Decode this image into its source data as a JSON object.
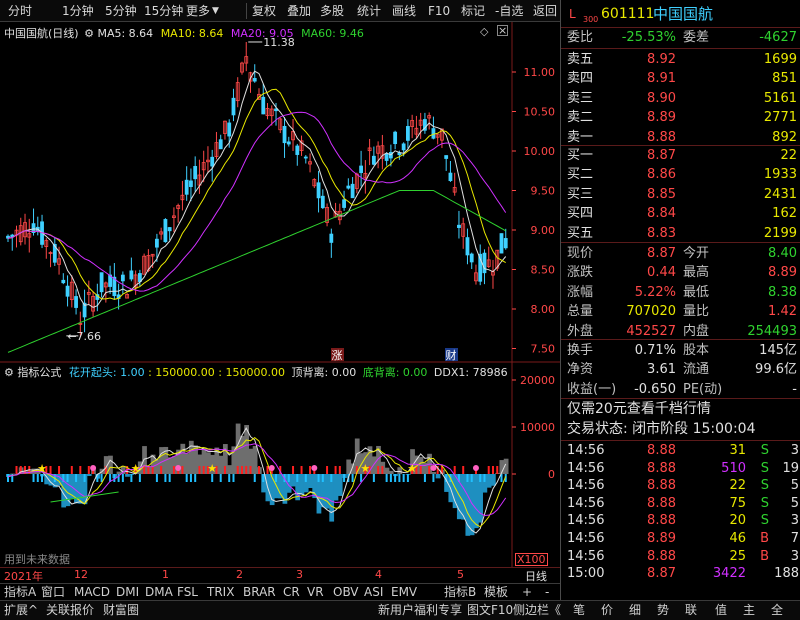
{
  "toolbar": {
    "items": [
      "分时",
      "1分钟",
      "5分钟",
      "15分钟",
      "更多",
      "复权",
      "叠加",
      "多股",
      "统计",
      "画线",
      "F10",
      "标记",
      "-自选",
      "返回"
    ]
  },
  "main_chart": {
    "stock_name": "中国国航",
    "period": "(日线)",
    "ma5": "MA5: 8.64",
    "ma10": "MA10: 8.64",
    "ma20": "MA20: 9.05",
    "ma60": "MA60: 9.46",
    "high_label": "11.38",
    "low_label": "7.66",
    "price_ticks": [
      "11.00",
      "10.50",
      "10.00",
      "9.50",
      "9.00",
      "8.50",
      "8.00",
      "7.50"
    ],
    "markers": [
      "涨",
      "财"
    ]
  },
  "indicator": {
    "name": "指标公式",
    "f1": "花开起头: 1.00",
    "f2": "150000.00",
    "f3": "150000.00",
    "f4": "顶背离: 0.00",
    "f5": "底背离: 0.00",
    "f6": "DDX1: 78986",
    "ticks": [
      "20000",
      "10000",
      "0"
    ],
    "scale": "X100",
    "note": "用到未来数据"
  },
  "date_axis": {
    "labels": [
      "2021年",
      "12",
      "1",
      "2",
      "3",
      "4",
      "5"
    ],
    "period_tab": "日线"
  },
  "tabs1": [
    "指标A",
    "窗口",
    "MACD",
    "DMI",
    "DMA",
    "FSL",
    "TRIX",
    "BRAR",
    "CR",
    "VR",
    "OBV",
    "ASI",
    "EMV",
    "指标B",
    "模板",
    "+",
    "-"
  ],
  "tabs2": [
    "扩展^",
    "关联报价",
    "财富圈",
    "新用户福利专享",
    "图文F10",
    "侧边栏《"
  ],
  "panel": {
    "l_badge": "L",
    "code_sub": "300",
    "code": "601111",
    "name": "中国国航",
    "weibi_label": "委比",
    "weibi": "-25.53%",
    "weicha_label": "委差",
    "weicha": "-4627",
    "asks": [
      {
        "label": "卖五",
        "price": "8.92",
        "vol": "1699"
      },
      {
        "label": "卖四",
        "price": "8.91",
        "vol": "851"
      },
      {
        "label": "卖三",
        "price": "8.90",
        "vol": "5161"
      },
      {
        "label": "卖二",
        "price": "8.89",
        "vol": "2771"
      },
      {
        "label": "卖一",
        "price": "8.88",
        "vol": "892"
      }
    ],
    "bids": [
      {
        "label": "买一",
        "price": "8.87",
        "vol": "22"
      },
      {
        "label": "买二",
        "price": "8.86",
        "vol": "1933"
      },
      {
        "label": "买三",
        "price": "8.85",
        "vol": "2431"
      },
      {
        "label": "买四",
        "price": "8.84",
        "vol": "162"
      },
      {
        "label": "买五",
        "price": "8.83",
        "vol": "2199"
      }
    ],
    "stats": [
      {
        "l1": "现价",
        "v1": "8.87",
        "c1": "red",
        "l2": "今开",
        "v2": "8.40",
        "c2": "green"
      },
      {
        "l1": "涨跌",
        "v1": "0.44",
        "c1": "red",
        "l2": "最高",
        "v2": "8.89",
        "c2": "red"
      },
      {
        "l1": "涨幅",
        "v1": "5.22%",
        "c1": "red",
        "l2": "最低",
        "v2": "8.38",
        "c2": "green"
      },
      {
        "l1": "总量",
        "v1": "707020",
        "c1": "yellow",
        "l2": "量比",
        "v2": "1.42",
        "c2": "red"
      },
      {
        "l1": "外盘",
        "v1": "452527",
        "c1": "red",
        "l2": "内盘",
        "v2": "254493",
        "c2": "green"
      }
    ],
    "stats2": [
      {
        "l1": "换手",
        "v1": "0.71%",
        "l2": "股本",
        "v2": "145亿"
      },
      {
        "l1": "净资",
        "v1": "3.61",
        "l2": "流通",
        "v2": "99.6亿"
      },
      {
        "l1": "收益(一)",
        "v1": "-0.650",
        "l2": "PE(动)",
        "v2": "-"
      }
    ],
    "promo": "仅需20元查看千档行情",
    "status": "交易状态: 闭市阶段 15:00:04",
    "ticks": [
      {
        "t": "14:56",
        "p": "8.88",
        "v": "31",
        "vc": "yellow",
        "d": "S",
        "dc": "green",
        "n": "3"
      },
      {
        "t": "14:56",
        "p": "8.88",
        "v": "510",
        "vc": "purple",
        "d": "S",
        "dc": "green",
        "n": "19"
      },
      {
        "t": "14:56",
        "p": "8.88",
        "v": "22",
        "vc": "yellow",
        "d": "S",
        "dc": "green",
        "n": "5"
      },
      {
        "t": "14:56",
        "p": "8.88",
        "v": "75",
        "vc": "yellow",
        "d": "S",
        "dc": "green",
        "n": "5"
      },
      {
        "t": "14:56",
        "p": "8.88",
        "v": "20",
        "vc": "yellow",
        "d": "S",
        "dc": "green",
        "n": "3"
      },
      {
        "t": "14:56",
        "p": "8.89",
        "v": "46",
        "vc": "yellow",
        "d": "B",
        "dc": "red",
        "n": "7"
      },
      {
        "t": "14:56",
        "p": "8.88",
        "v": "25",
        "vc": "yellow",
        "d": "B",
        "dc": "red",
        "n": "3"
      },
      {
        "t": "15:00",
        "p": "8.87",
        "v": "3422",
        "vc": "purple",
        "d": "",
        "dc": "white",
        "n": "188"
      }
    ],
    "bottom_tabs": [
      "笔",
      "价",
      "细",
      "势",
      "联",
      "值",
      "主",
      "全"
    ]
  }
}
